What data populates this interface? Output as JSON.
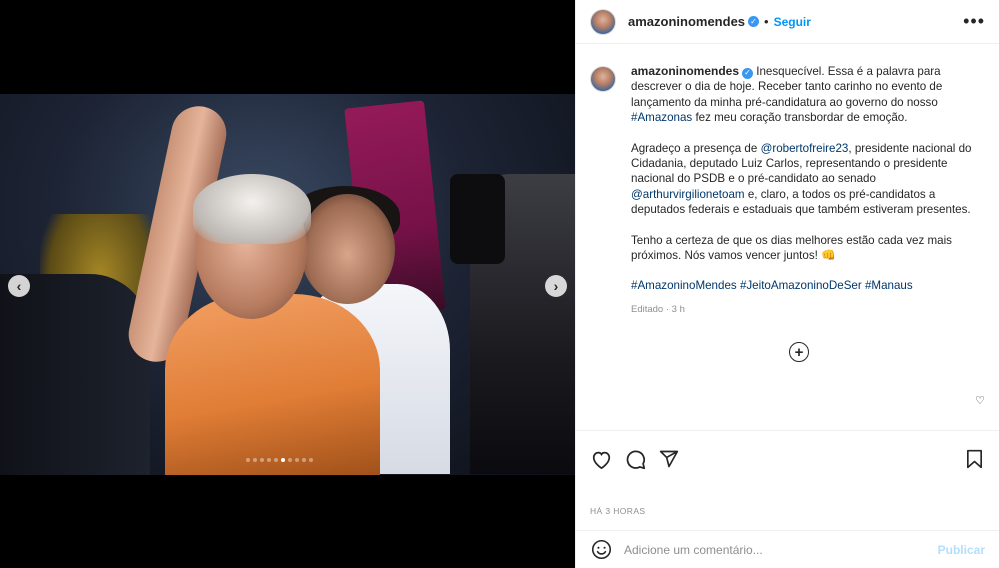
{
  "post": {
    "username": "amazoninomendes",
    "header_sep": "•",
    "follow_label": "Seguir",
    "more_label": "•••",
    "caption": {
      "p1": "Inesquecível. Essa é a palavra para descrever o dia de hoje. Receber tanto carinho no evento de lançamento da minha pré-candidatura ao governo do nosso ",
      "p1_tag": "#Amazonas",
      "p1_end": " fez meu coração transbordar de emoção.",
      "p2_a": "Agradeço a presença de ",
      "p2_mention1": "@robertofreire23",
      "p2_b": ", presidente nacional do Cidadania, deputado Luiz Carlos, representando o presidente nacional do PSDB e o pré-candidato ao senado ",
      "p2_mention2": "@arthurvirgilionetoam",
      "p2_c": " e, claro, a todos os pré-candidatos a deputados federais e estaduais que também estiveram presentes.",
      "p3": "Tenho a certeza de que os dias melhores estão cada vez mais próximos. Nós vamos vencer juntos! 👊",
      "tag1": "#AmazoninoMendes",
      "tag2": "#JeitoAmazoninoDeSer",
      "tag3": "#Manaus"
    },
    "edited_label": "Editado · 3 h",
    "time_label": "HÁ 3 HORAS",
    "comment_placeholder": "Adicione um comentário...",
    "publish_label": "Publicar"
  },
  "carousel": {
    "prev": "‹",
    "next": "›",
    "dot_count": 10,
    "active_index": 5
  },
  "colors": {
    "link": "#00376b",
    "follow": "#0095f6",
    "verified": "#3897f0",
    "muted": "#8e8e8e"
  }
}
